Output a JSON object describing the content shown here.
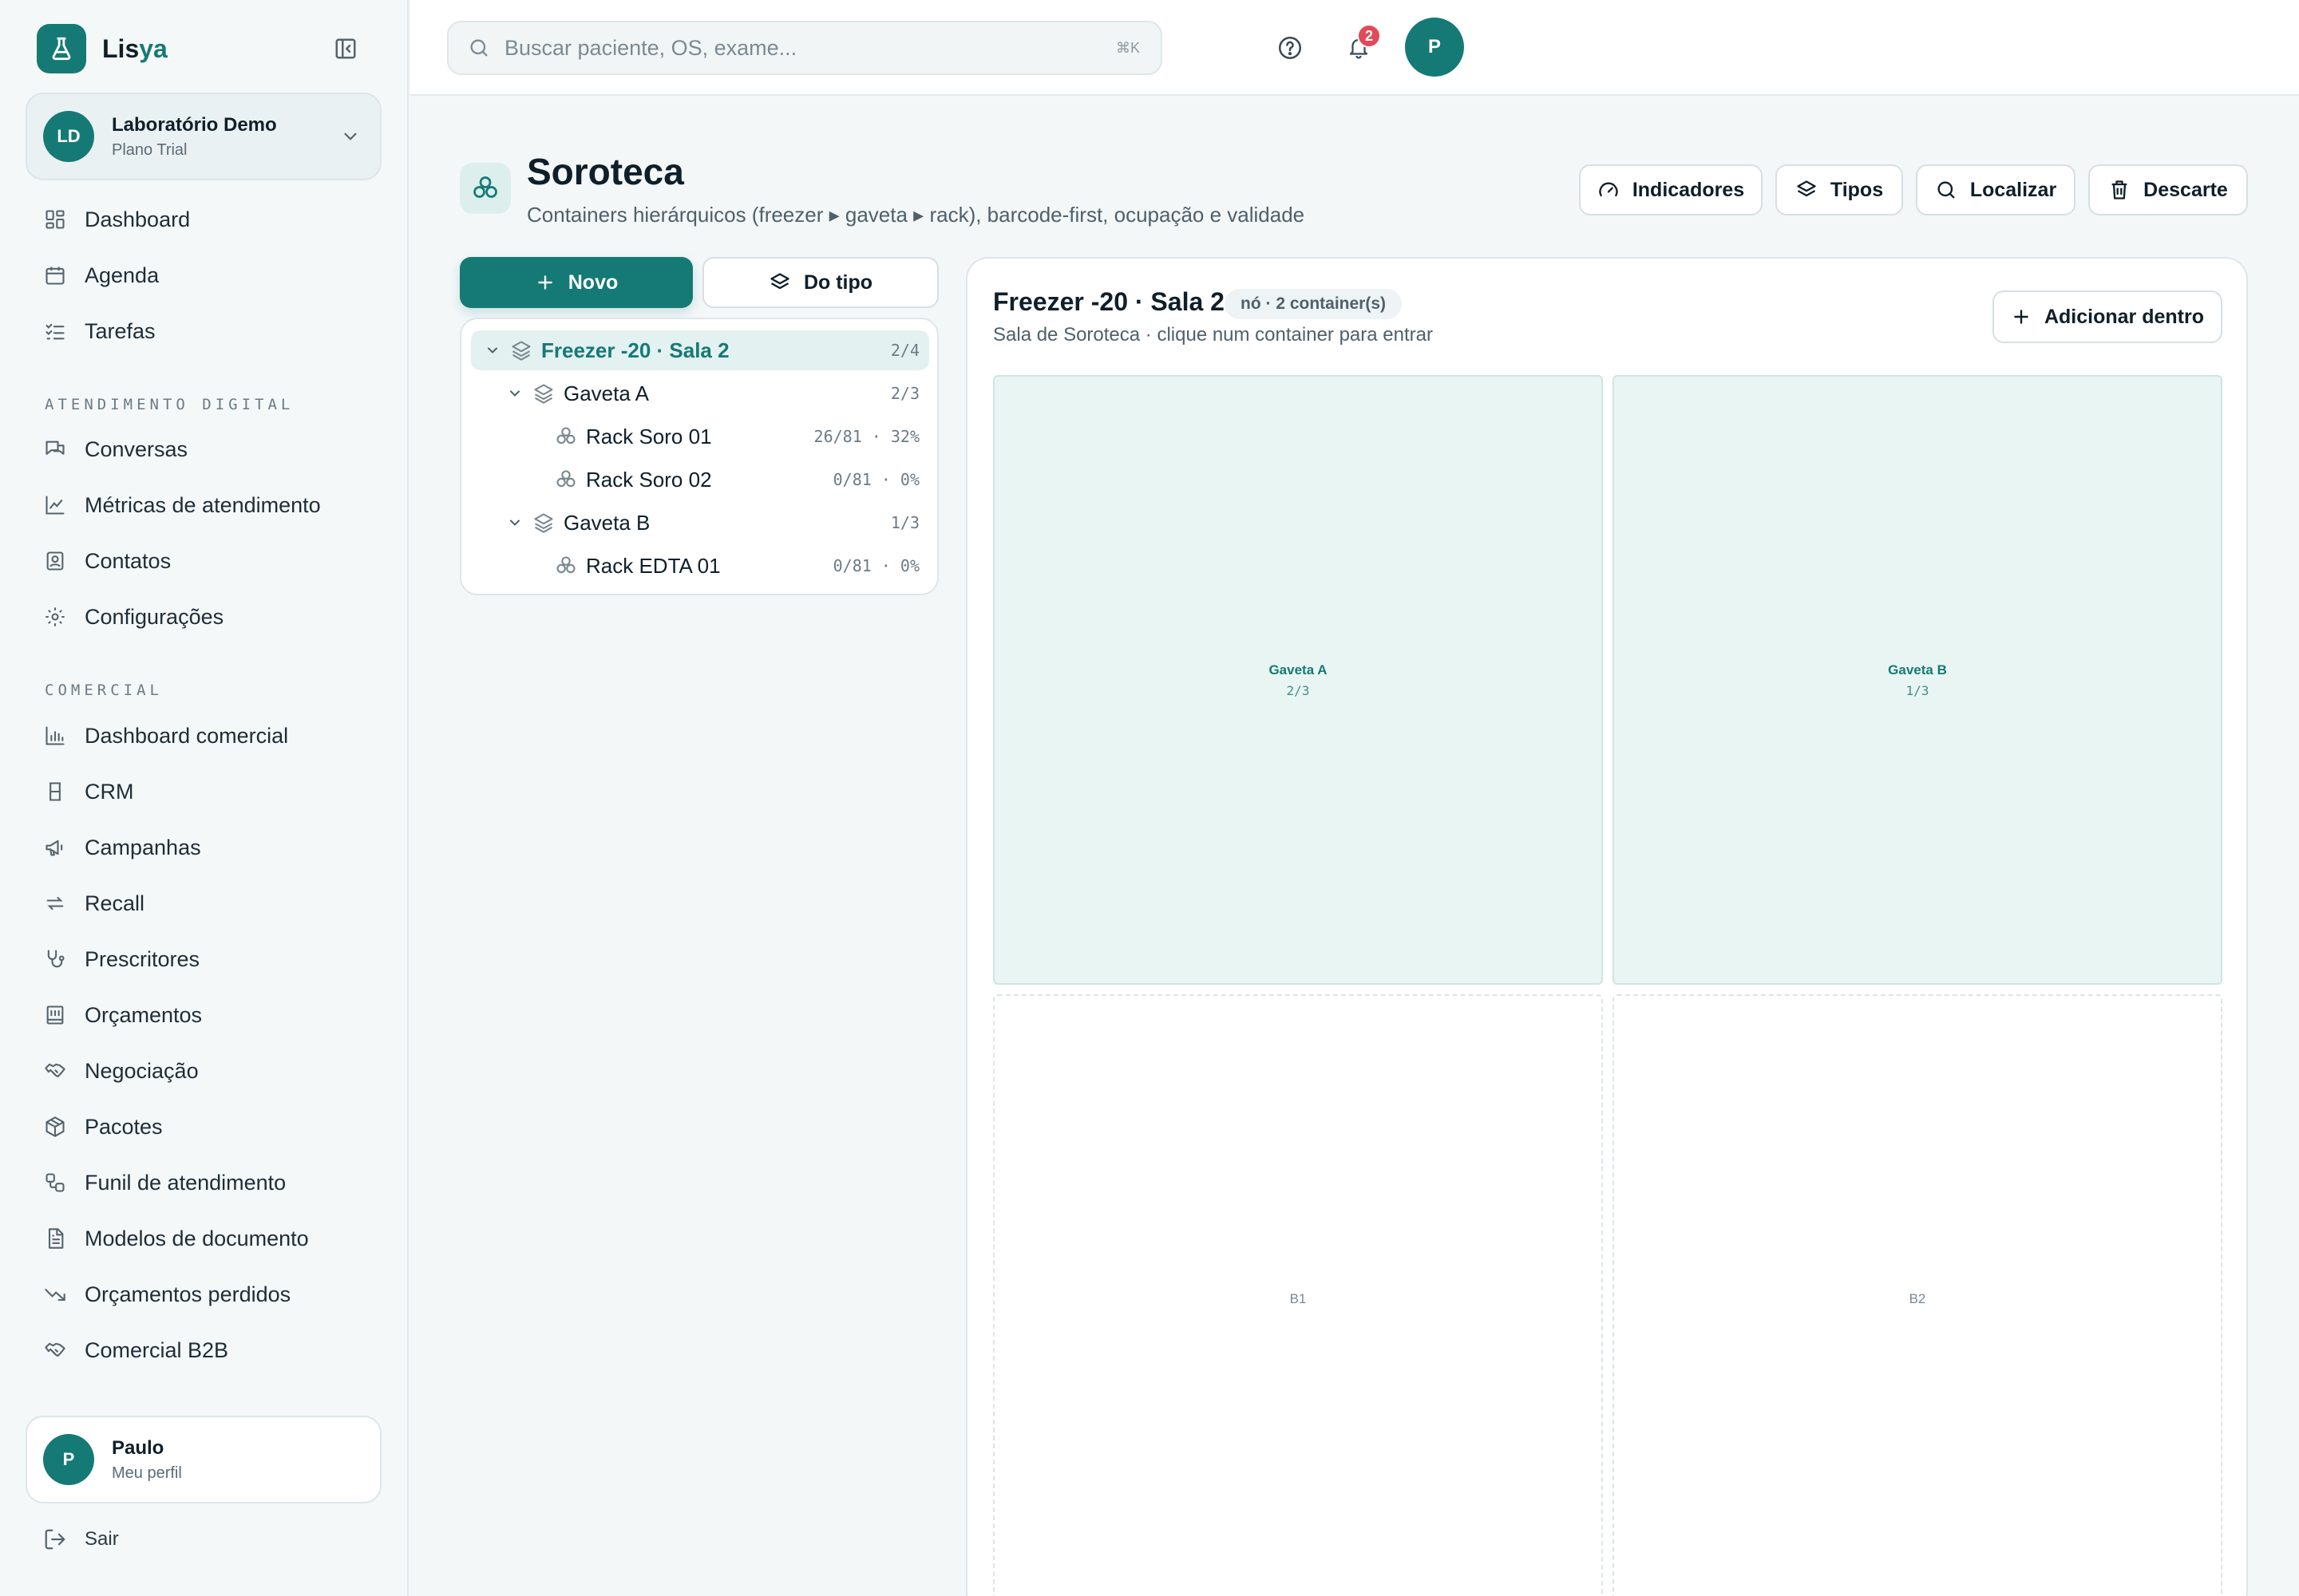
{
  "brand": {
    "name_a": "Lis",
    "name_b": "ya"
  },
  "lab": {
    "initials": "LD",
    "name": "Laboratório Demo",
    "plan": "Plano Trial"
  },
  "nav_main": [
    {
      "label": "Dashboard",
      "icon": "dashboard-icon"
    },
    {
      "label": "Agenda",
      "icon": "calendar-icon"
    },
    {
      "label": "Tarefas",
      "icon": "task-list-icon"
    }
  ],
  "section_digital": "ATENDIMENTO DIGITAL",
  "nav_digital": [
    {
      "label": "Conversas",
      "icon": "chat-icon"
    },
    {
      "label": "Métricas de atendimento",
      "icon": "line-chart-icon"
    },
    {
      "label": "Contatos",
      "icon": "contact-icon"
    },
    {
      "label": "Configurações",
      "icon": "gear-icon"
    }
  ],
  "section_comercial": "COMERCIAL",
  "nav_comercial": [
    {
      "label": "Dashboard comercial",
      "icon": "bar-chart-icon"
    },
    {
      "label": "CRM",
      "icon": "crm-icon"
    },
    {
      "label": "Campanhas",
      "icon": "megaphone-icon"
    },
    {
      "label": "Recall",
      "icon": "repeat-icon"
    },
    {
      "label": "Prescritores",
      "icon": "stethoscope-icon"
    },
    {
      "label": "Orçamentos",
      "icon": "budget-icon"
    },
    {
      "label": "Negociação",
      "icon": "handshake-icon"
    },
    {
      "label": "Pacotes",
      "icon": "package-icon"
    },
    {
      "label": "Funil de atendimento",
      "icon": "funnel-icon"
    },
    {
      "label": "Modelos de documento",
      "icon": "document-icon"
    },
    {
      "label": "Orçamentos perdidos",
      "icon": "trending-down-icon"
    },
    {
      "label": "Comercial B2B",
      "icon": "handshake-icon"
    }
  ],
  "user": {
    "initial": "P",
    "name": "Paulo",
    "sub": "Meu perfil"
  },
  "logout_label": "Sair",
  "search": {
    "placeholder": "Buscar paciente, OS, exame...",
    "shortcut": "⌘K"
  },
  "notifications": {
    "count": "2"
  },
  "top_avatar": "P",
  "page": {
    "title": "Soroteca",
    "subtitle": "Containers hierárquicos (freezer ▸ gaveta ▸ rack), barcode-first, ocupação e validade"
  },
  "header_buttons": {
    "indicadores": "Indicadores",
    "tipos": "Tipos",
    "localizar": "Localizar",
    "descarte": "Descarte"
  },
  "actions": {
    "novo": "Novo",
    "do_tipo": "Do tipo"
  },
  "tree": [
    {
      "name": "Freezer -20 · Sala 2",
      "meta": "2/4",
      "level": 0,
      "expandable": true,
      "selected": true
    },
    {
      "name": "Gaveta A",
      "meta": "2/3",
      "level": 1,
      "expandable": true,
      "selected": false
    },
    {
      "name": "Rack Soro 01",
      "meta": "26/81 · 32%",
      "level": 2,
      "expandable": false,
      "selected": false
    },
    {
      "name": "Rack Soro 02",
      "meta": "0/81 · 0%",
      "level": 2,
      "expandable": false,
      "selected": false
    },
    {
      "name": "Gaveta B",
      "meta": "1/3",
      "level": 1,
      "expandable": true,
      "selected": false
    },
    {
      "name": "Rack EDTA 01",
      "meta": "0/81 · 0%",
      "level": 2,
      "expandable": false,
      "selected": false
    }
  ],
  "panel": {
    "title": "Freezer -20 · Sala 2",
    "chip": "nó · 2 container(s)",
    "subtitle": "Sala de Soroteca · clique num container para entrar",
    "add_button": "Adicionar dentro",
    "cells": [
      {
        "name": "Gaveta A",
        "meta": "2/3",
        "filled": true
      },
      {
        "name": "Gaveta B",
        "meta": "1/3",
        "filled": true
      },
      {
        "name": "B1",
        "meta": "",
        "filled": false
      },
      {
        "name": "B2",
        "meta": "",
        "filled": false
      }
    ]
  },
  "colors": {
    "accent": "#157a75",
    "badge": "#e14a5a"
  }
}
